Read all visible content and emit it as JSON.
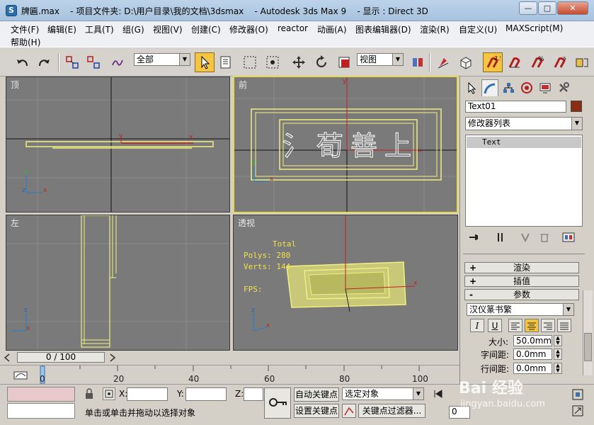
{
  "window": {
    "title": "牌匾.max    - 项目文件夹: D:\\用户目录\\我的文档\\3dsmax    - Autodesk 3ds Max 9    - 显示 : Direct 3D",
    "minimize": "—",
    "maximize": "□",
    "close": "✕"
  },
  "menu": {
    "items": [
      "文件(F)",
      "编辑(E)",
      "工具(T)",
      "组(G)",
      "视图(V)",
      "创建(C)",
      "修改器(O)",
      "reactor",
      "动画(A)",
      "图表编辑器(D)",
      "渲染(R)",
      "自定义(U)",
      "MAXScript(M)"
    ],
    "help": "帮助(H)"
  },
  "toolbar": {
    "selection_filter": "全部",
    "reference_coord": "视图"
  },
  "viewports": {
    "top": {
      "label": "顶"
    },
    "front": {
      "label": "前",
      "text_glyphs": [
        "氵",
        "荀",
        "善",
        "上"
      ]
    },
    "left": {
      "label": "左"
    },
    "perspective": {
      "label": "透视",
      "stats_total": "Total",
      "polys": "Polys: 280",
      "verts": "Verts: 144",
      "fps": "FPS:"
    }
  },
  "command_panel": {
    "object_name": "Text01",
    "object_color": "#8b2e12",
    "modifier_list": "修改器列表",
    "stack_item": "Text",
    "rollouts": {
      "render": "渲染",
      "interpolation": "插值",
      "parameters": "参数"
    },
    "rollout_signs": {
      "collapsed": "+",
      "expanded": "-"
    },
    "font_name": "汉仪篆书繁",
    "format_buttons": [
      "I",
      "U"
    ],
    "size_label": "大小:",
    "size_value": "50.0mm",
    "kerning_label": "字间距:",
    "kerning_value": "0.0mm",
    "leading_label": "行间距:",
    "leading_value": "0.0mm"
  },
  "timeline": {
    "slider_text": "0 / 100",
    "ticks": [
      "0",
      "20",
      "40",
      "60",
      "80",
      "100"
    ]
  },
  "status": {
    "x_label": "X:",
    "y_label": "Y:",
    "z_label": "Z:",
    "autokey": "自动关键点",
    "setkey": "设置关键点",
    "selected_dropdown": "选定对象",
    "key_filters": "关键点过滤器...",
    "frame_value": "0",
    "prompt": "单击或单击并拖动以选择对象"
  },
  "watermark": {
    "text": "Bai 经验",
    "url": "jingyan.baidu.com"
  }
}
